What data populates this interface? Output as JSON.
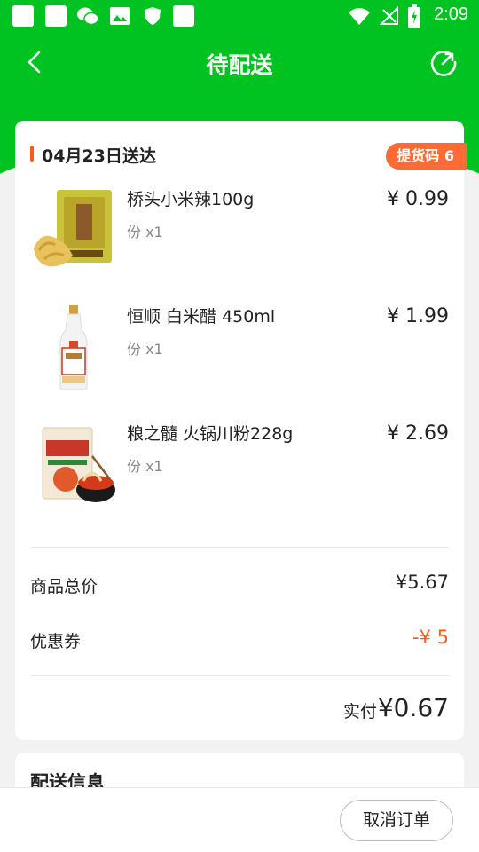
{
  "status_bar": {
    "time": "2:09"
  },
  "navbar": {
    "title": "待配送"
  },
  "order": {
    "date_label": "04月23日送达",
    "pickup_code": "提货码 6",
    "items": [
      {
        "name": "桥头小米辣100g",
        "qty": "份  x1",
        "price": "¥ 0.99"
      },
      {
        "name": "恒顺 白米醋  450ml",
        "qty": "份  x1",
        "price": "¥ 1.99"
      },
      {
        "name": "粮之髓 火锅川粉228g",
        "qty": "份  x1",
        "price": "¥ 2.69"
      }
    ],
    "subtotal_label": "商品总价",
    "subtotal_value": "¥5.67",
    "coupon_label": "优惠券",
    "coupon_value": "-¥ 5",
    "paid_label": "实付",
    "paid_value": "¥0.67"
  },
  "delivery": {
    "title": "配送信息"
  },
  "bottom_bar": {
    "cancel_label": "取消订单"
  },
  "colors": {
    "brand_green": "#00c321",
    "accent_orange": "#ff5a1e"
  },
  "icons": [
    "back-arrow-icon",
    "refresh-icon",
    "wifi-icon",
    "signal-icon",
    "battery-icon"
  ]
}
